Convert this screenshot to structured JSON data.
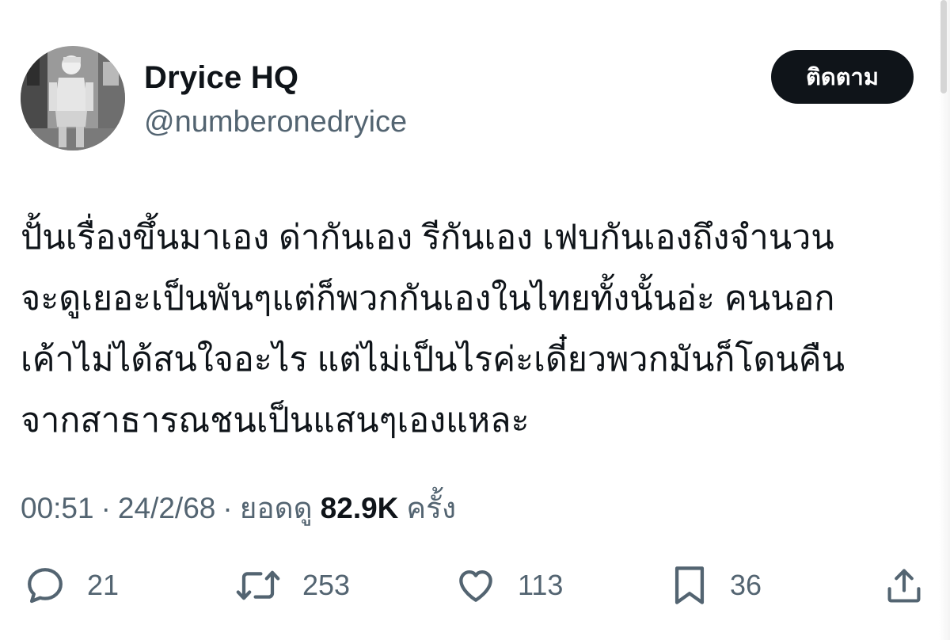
{
  "author": {
    "display_name": "Dryice HQ",
    "handle": "@numberonedryice"
  },
  "follow_button": {
    "label": "ติดตาม"
  },
  "tweet": {
    "lines": [
      "ปั้นเรื่องขึ้นมาเอง ด่ากันเอง รีกันเอง เฟบกันเองถึงจำนวน",
      "จะดูเยอะเป็นพันๆแต่ก็พวกกันเองในไทยทั้งนั้นอ่ะ คนนอก",
      "เค้าไม่ได้สนใจอะไร แต่ไม่เป็นไรค่ะเดี๋ยวพวกมันก็โดนคืน",
      "จากสาธารณชนเป็นแสนๆเองแหละ"
    ]
  },
  "meta": {
    "time": "00:51",
    "date": "24/2/68",
    "views_label": "ยอดดู",
    "views_count": "82.9K",
    "views_suffix": "ครั้ง",
    "separator": "·"
  },
  "actions": {
    "reply": {
      "icon": "reply-icon",
      "count": "21"
    },
    "repost": {
      "icon": "repost-icon",
      "count": "253"
    },
    "like": {
      "icon": "heart-icon",
      "count": "113"
    },
    "bookmark": {
      "icon": "bookmark-icon",
      "count": "36"
    },
    "share": {
      "icon": "share-icon"
    }
  },
  "colors": {
    "text_primary": "#0f1419",
    "text_secondary": "#536471",
    "button_bg": "#0f1419",
    "button_text": "#ffffff",
    "background": "#ffffff"
  }
}
